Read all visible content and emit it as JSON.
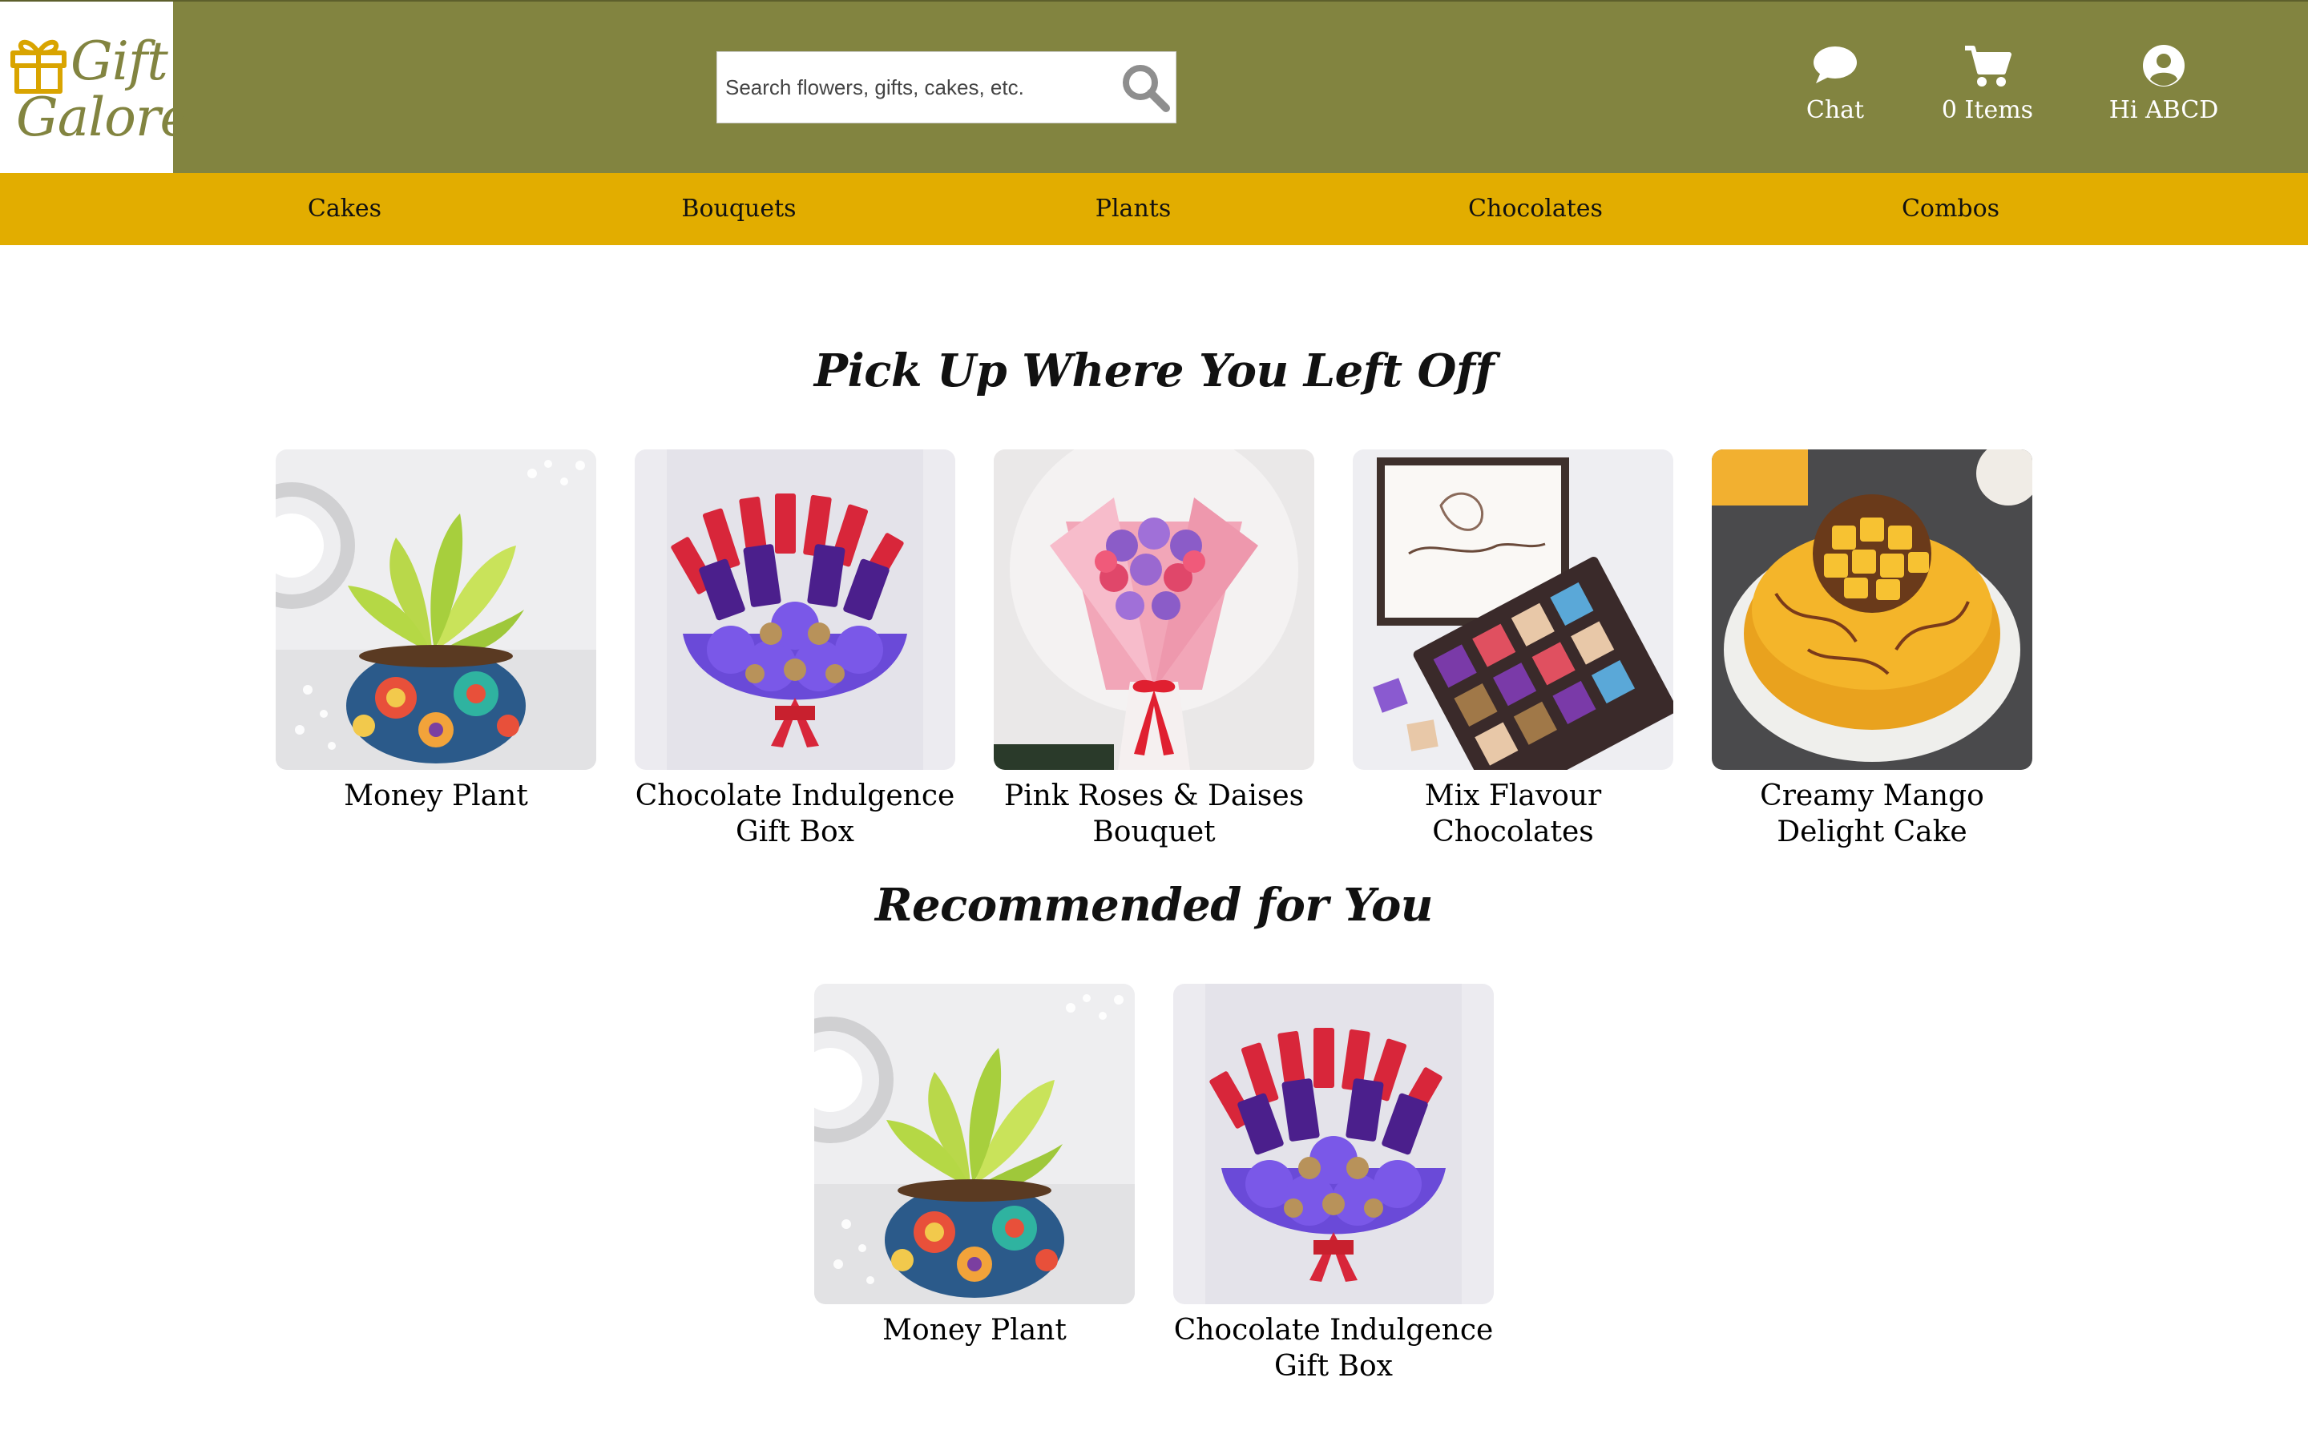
{
  "brand": {
    "line1": "Gift",
    "line2": "Galore",
    "icon": "gift-icon",
    "color": "#828440"
  },
  "search": {
    "placeholder": "Search flowers, gifts, cakes, etc.",
    "value": "",
    "icon": "search-icon"
  },
  "header_actions": {
    "chat": {
      "label": "Chat",
      "icon": "chat-bubble-icon"
    },
    "cart": {
      "label": "0 Items",
      "icon": "cart-icon"
    },
    "account": {
      "label": "Hi ABCD",
      "icon": "user-circle-icon"
    }
  },
  "nav": {
    "items": [
      "Cakes",
      "Bouquets",
      "Plants",
      "Chocolates",
      "Combos"
    ]
  },
  "colors": {
    "header_bg": "#828440",
    "nav_bg": "#e2ad00",
    "page_bg": "#ffffff"
  },
  "recent": {
    "title": "Pick Up Where You Left Off",
    "products": [
      {
        "name": "Money Plant",
        "image": "money-plant-image"
      },
      {
        "name": "Chocolate Indulgence Gift Box",
        "image": "chocolate-bouquet-image"
      },
      {
        "name": "Pink Roses & Daises Bouquet",
        "image": "flower-bouquet-image"
      },
      {
        "name": "Mix Flavour Chocolates",
        "image": "chocolate-box-image"
      },
      {
        "name": "Creamy Mango Delight Cake",
        "image": "mango-cake-image"
      }
    ]
  },
  "recommended": {
    "title": "Recommended for You",
    "products": [
      {
        "name": "Money Plant",
        "image": "money-plant-image"
      },
      {
        "name": "Chocolate Indulgence Gift Box",
        "image": "chocolate-bouquet-image"
      }
    ]
  }
}
